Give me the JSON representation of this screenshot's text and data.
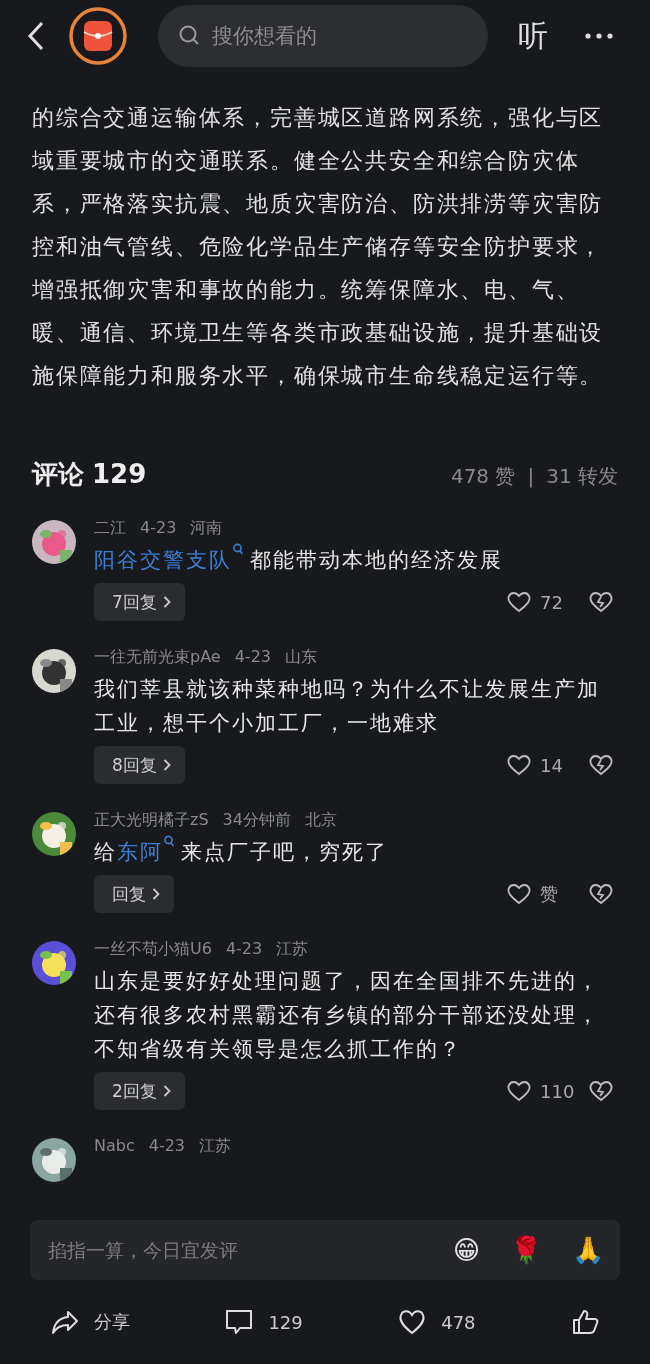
{
  "header": {
    "search_placeholder": "搜你想看的",
    "listen_label": "听"
  },
  "article": {
    "text": "的综合交通运输体系，完善城区道路网系统，强化与区域重要城市的交通联系。健全公共安全和综合防灾体系，严格落实抗震、地质灾害防治、防洪排涝等灾害防控和油气管线、危险化学品生产储存等安全防护要求，增强抵御灾害和事故的能力。统筹保障水、电、气、暖、通信、环境卫生等各类市政基础设施，提升基础设施保障能力和服务水平，确保城市生命线稳定运行等。"
  },
  "comments_header": {
    "title": "评论",
    "count": "129",
    "likes": "478 赞",
    "separator": "|",
    "shares": "31 转发"
  },
  "comments": [
    {
      "user": "二江",
      "time": "4-23",
      "region": "河南",
      "avatar": {
        "kind": "picture"
      },
      "content": [
        {
          "kind": "link",
          "text": "阳谷交警支队"
        },
        {
          "kind": "plain",
          "text": "都能带动本地的经济发展"
        }
      ],
      "replies": "7回复",
      "likes": "72"
    },
    {
      "user": "一往无前光束pAe",
      "time": "4-23",
      "region": "山东",
      "avatar": {
        "kind": "picture"
      },
      "content": [
        {
          "kind": "plain",
          "text": "我们莘县就该种菜种地吗？为什么不让发展生产加工业，想干个小加工厂，一地难求"
        }
      ],
      "replies": "8回复",
      "likes": "14"
    },
    {
      "user": "正大光明橘子zS",
      "time": "34分钟前",
      "region": "北京",
      "avatar": {
        "kind": "picture"
      },
      "content": [
        {
          "kind": "plain",
          "text": "给"
        },
        {
          "kind": "link",
          "text": "东阿"
        },
        {
          "kind": "plain",
          "text": "来点厂子吧，穷死了"
        }
      ],
      "replies": "回复",
      "likes": "赞"
    },
    {
      "user": "一丝不苟小猫U6",
      "time": "4-23",
      "region": "江苏",
      "avatar": {
        "kind": "picture"
      },
      "content": [
        {
          "kind": "plain",
          "text": "山东是要好好处理问题了，因在全国排不先进的，还有很多农村黑霸还有乡镇的部分干部还没处理，不知省级有关领导是怎么抓工作的？"
        }
      ],
      "replies": "2回复",
      "likes": "110"
    },
    {
      "user": "Nabc",
      "time": "4-23",
      "region": "江苏",
      "avatar": {
        "kind": "picture"
      }
    }
  ],
  "input": {
    "placeholder": "掐指一算，今日宜发评",
    "emojis": [
      "😁",
      "🌹",
      "🙏"
    ]
  },
  "bottom_bar": {
    "share": "分享",
    "comments": "129",
    "likes": "478"
  }
}
